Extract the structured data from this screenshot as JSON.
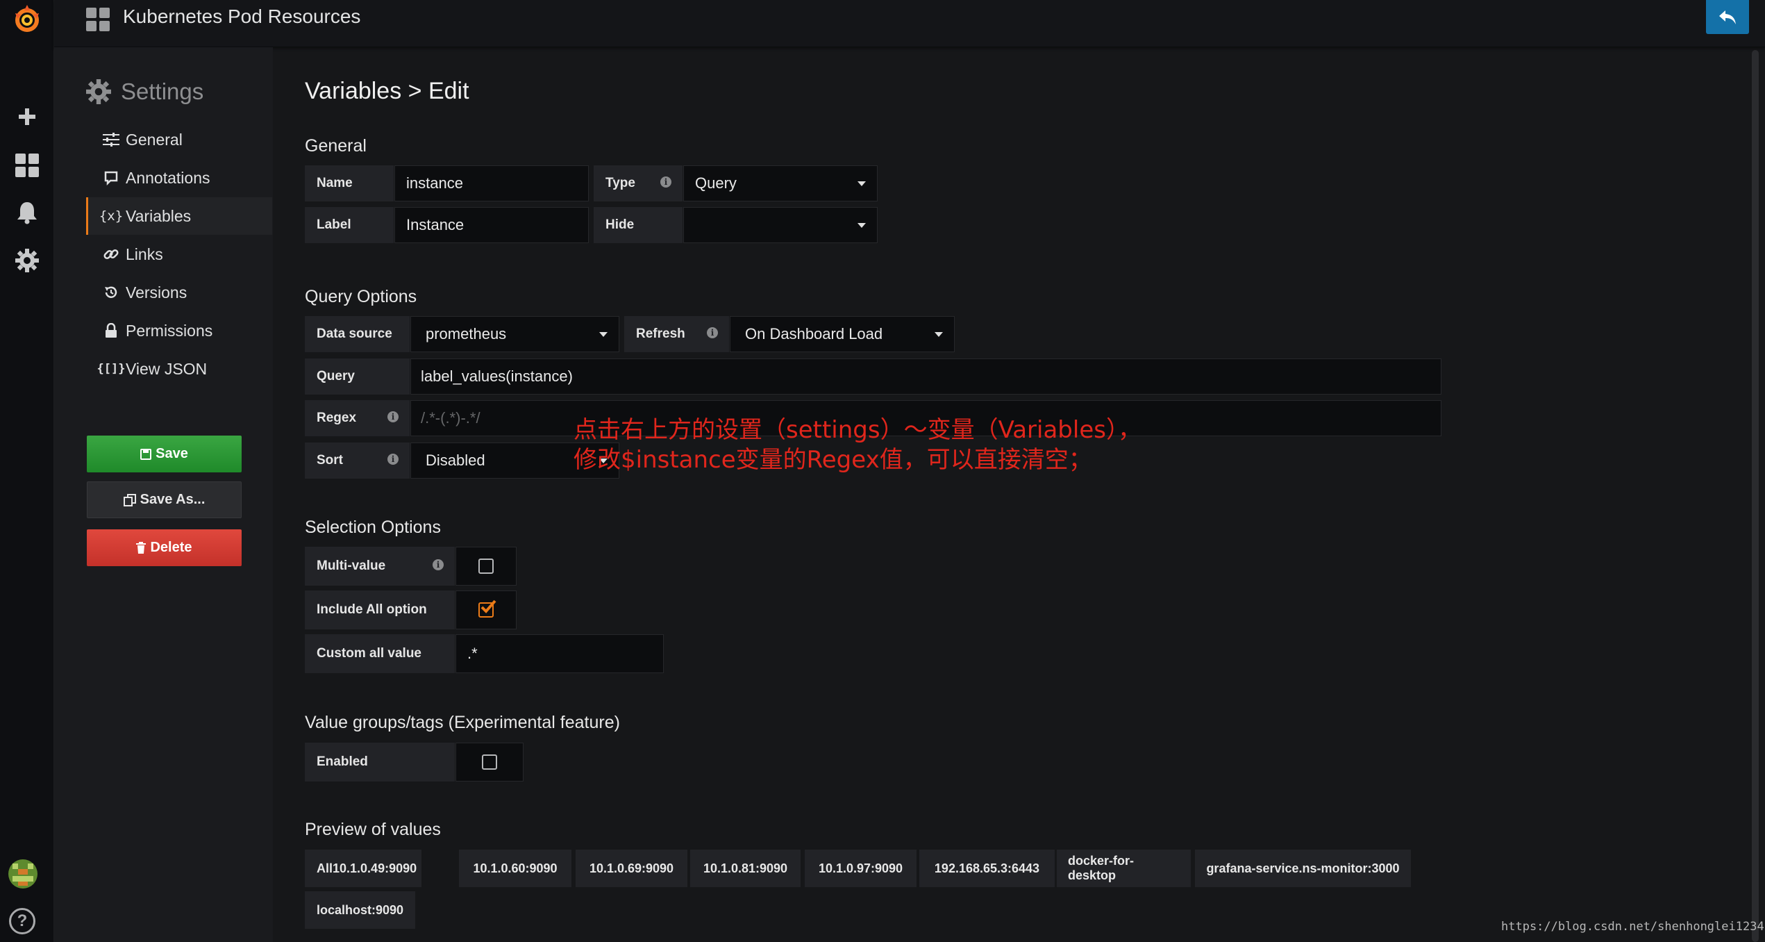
{
  "navbar": {
    "title": "Kubernetes Pod Resources"
  },
  "settings": {
    "title": "Settings",
    "items": [
      {
        "label": "General",
        "icon": "sliders-icon"
      },
      {
        "label": "Annotations",
        "icon": "comment-icon"
      },
      {
        "label": "Variables",
        "icon": "variable-icon"
      },
      {
        "label": "Links",
        "icon": "link-icon"
      },
      {
        "label": "Versions",
        "icon": "history-icon"
      },
      {
        "label": "Permissions",
        "icon": "lock-icon"
      },
      {
        "label": "View JSON",
        "icon": "json-icon"
      }
    ],
    "active": "Variables",
    "save": "Save",
    "save_as": "Save As...",
    "delete": "Delete"
  },
  "page": {
    "title": "Variables > Edit"
  },
  "general": {
    "title": "General",
    "name_label": "Name",
    "name_value": "instance",
    "type_label": "Type",
    "type_value": "Query",
    "label_label": "Label",
    "label_value": "Instance",
    "hide_label": "Hide",
    "hide_value": ""
  },
  "query_options": {
    "title": "Query Options",
    "datasource_label": "Data source",
    "datasource_value": "prometheus",
    "refresh_label": "Refresh",
    "refresh_value": "On Dashboard Load",
    "query_label": "Query",
    "query_value": "label_values(instance)",
    "regex_label": "Regex",
    "regex_placeholder": "/.*-(.*)-.*/",
    "sort_label": "Sort",
    "sort_value": "Disabled"
  },
  "selection_options": {
    "title": "Selection Options",
    "multi_label": "Multi-value",
    "multi_checked": false,
    "include_all_label": "Include All option",
    "include_all_checked": true,
    "custom_all_label": "Custom all value",
    "custom_all_value": ".*"
  },
  "value_groups": {
    "title": "Value groups/tags (Experimental feature)",
    "enabled_label": "Enabled",
    "enabled_checked": false
  },
  "annotation": {
    "line1": "点击右上方的设置（settings）～变量（Variables），",
    "line2": "修改$instance变量的Regex值，可以直接清空；"
  },
  "preview": {
    "title": "Preview of values",
    "values": [
      "All",
      "10.1.0.49:9090",
      "10.1.0.60:9090",
      "10.1.0.69:9090",
      "10.1.0.81:9090",
      "10.1.0.97:9090",
      "192.168.65.3:6443",
      "docker-for-desktop",
      "grafana-service.ns-monitor:3000",
      "localhost:9090"
    ]
  },
  "watermark": "https://blog.csdn.net/shenhonglei1234",
  "colors": {
    "accent": "#eb7b18",
    "save": "#299c32",
    "delete": "#d44a3a",
    "primary": "#1471a8",
    "annotation": "#e0261c"
  }
}
